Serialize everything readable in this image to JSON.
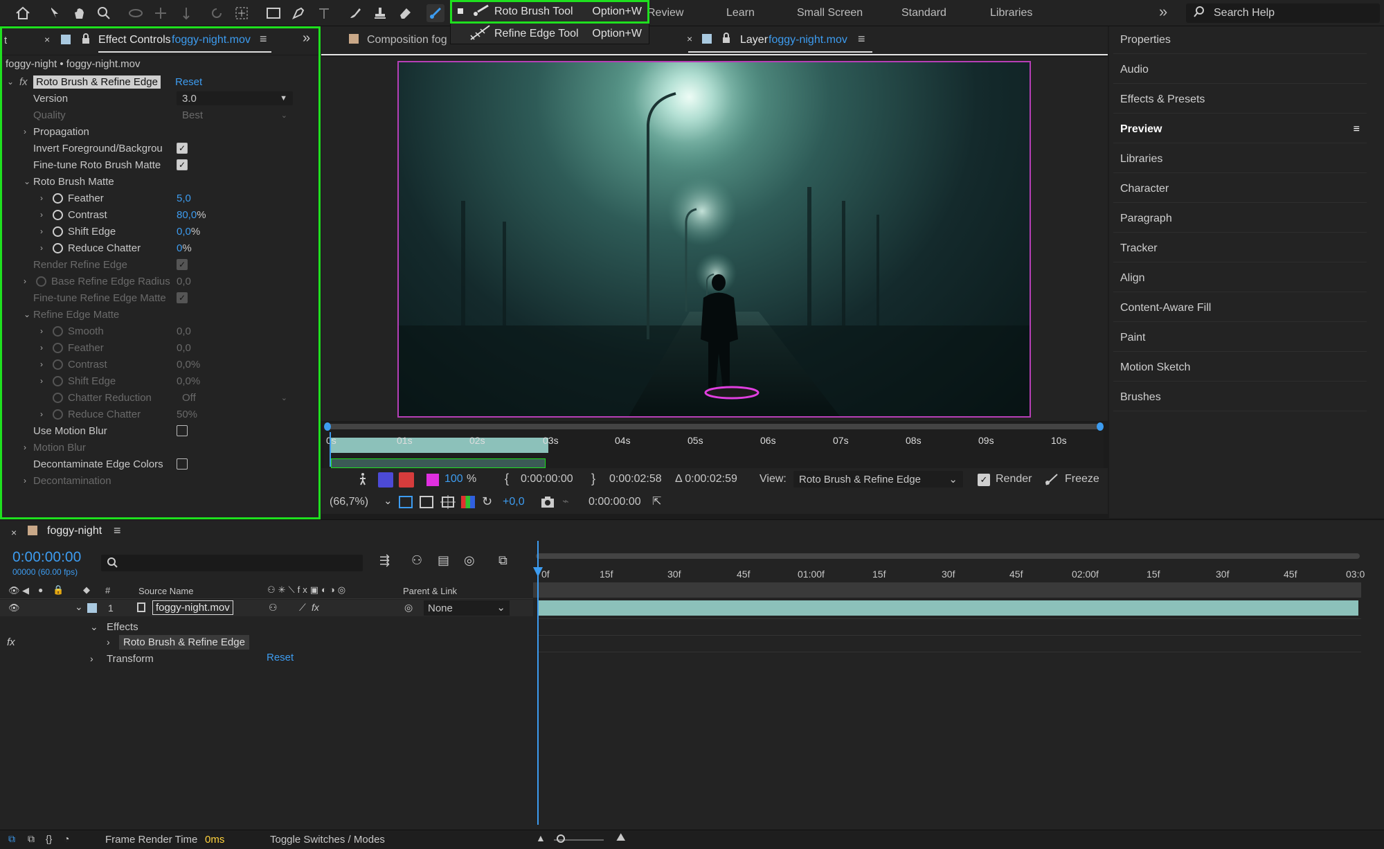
{
  "toolbar": {
    "workspaces": [
      "Review",
      "Learn",
      "Small Screen",
      "Standard",
      "Libraries"
    ],
    "search_placeholder": "Search Help",
    "overflow": "»"
  },
  "flyout": {
    "items": [
      {
        "label": "Roto Brush Tool",
        "shortcut": "Option+W"
      },
      {
        "label": "Refine Edge Tool",
        "shortcut": "Option+W"
      }
    ]
  },
  "effect_controls": {
    "tab_label": "Effect Controls",
    "tab_file": "foggy-night.mov",
    "left_stub": "t",
    "title": "foggy-night • foggy-night.mov",
    "effect_name": "Roto Brush & Refine Edge",
    "reset": "Reset",
    "rows": [
      {
        "label": "Version",
        "value": "3.0"
      },
      {
        "label": "Quality",
        "value": "Best"
      },
      {
        "label": "Propagation"
      },
      {
        "label": "Invert Foreground/Backgrou"
      },
      {
        "label": "Fine-tune Roto Brush Matte"
      },
      {
        "label": "Roto Brush Matte"
      },
      {
        "label": "Feather",
        "value": "5,0"
      },
      {
        "label": "Contrast",
        "value": "80,0",
        "unit": "%"
      },
      {
        "label": "Shift Edge",
        "value": "0,0",
        "unit": "%"
      },
      {
        "label": "Reduce Chatter",
        "value": "0",
        "unit": "%"
      },
      {
        "label": "Render Refine Edge"
      },
      {
        "label": "Base Refine Edge Radius",
        "value": "0,0"
      },
      {
        "label": "Fine-tune Refine Edge Matte"
      },
      {
        "label": "Refine Edge Matte"
      },
      {
        "label": "Smooth",
        "value": "0,0"
      },
      {
        "label": "Feather",
        "value": "0,0"
      },
      {
        "label": "Contrast",
        "value": "0,0%"
      },
      {
        "label": "Shift Edge",
        "value": "0,0%"
      },
      {
        "label": "Chatter Reduction",
        "value": "Off"
      },
      {
        "label": "Reduce Chatter",
        "value": "50%"
      },
      {
        "label": "Use Motion Blur"
      },
      {
        "label": "Motion Blur"
      },
      {
        "label": "Decontaminate Edge Colors"
      },
      {
        "label": "Decontamination"
      }
    ]
  },
  "comp_tabs": {
    "composition": "Composition fog",
    "layer_prefix": "Layer",
    "layer_file": "foggy-night.mov"
  },
  "viewer_ruler": {
    "ticks": [
      "0s",
      "01s",
      "02s",
      "03s",
      "04s",
      "05s",
      "06s",
      "07s",
      "08s",
      "09s",
      "10s"
    ]
  },
  "viewer_controls": {
    "zoom_pct": "100",
    "pct": "%",
    "in_time": "0:00:00:00",
    "out_time": "0:00:02:58",
    "duration": "Δ 0:00:02:59",
    "view_label": "View:",
    "view_value": "Roto Brush & Refine Edge",
    "render": "Render",
    "freeze": "Freeze",
    "magnification": "(66,7%)",
    "exposure": "+0,0",
    "timecode": "0:00:00:00"
  },
  "right_panel": {
    "items": [
      "Properties",
      "Audio",
      "Effects & Presets",
      "Preview",
      "Libraries",
      "Character",
      "Paragraph",
      "Tracker",
      "Align",
      "Content-Aware Fill",
      "Paint",
      "Motion Sketch",
      "Brushes"
    ]
  },
  "timeline": {
    "comp_name": "foggy-night",
    "timecode": "0:00:00:00",
    "fps": "00000 (60.00 fps)",
    "col_source": "Source Name",
    "col_parent": "Parent & Link",
    "col_num": "#",
    "layer_num": "1",
    "layer_name": "foggy-night.mov",
    "parent_value": "None",
    "effects": "Effects",
    "effect_item": "Roto Brush & Refine Edge",
    "transform": "Transform",
    "reset": "Reset",
    "ruler": [
      "0f",
      "15f",
      "30f",
      "45f",
      "01:00f",
      "15f",
      "30f",
      "45f",
      "02:00f",
      "15f",
      "30f",
      "45f",
      "03:0"
    ]
  },
  "status_bar": {
    "frame_render_label": "Frame Render Time",
    "frame_render_value": "0ms",
    "toggle": "Toggle Switches / Modes"
  }
}
